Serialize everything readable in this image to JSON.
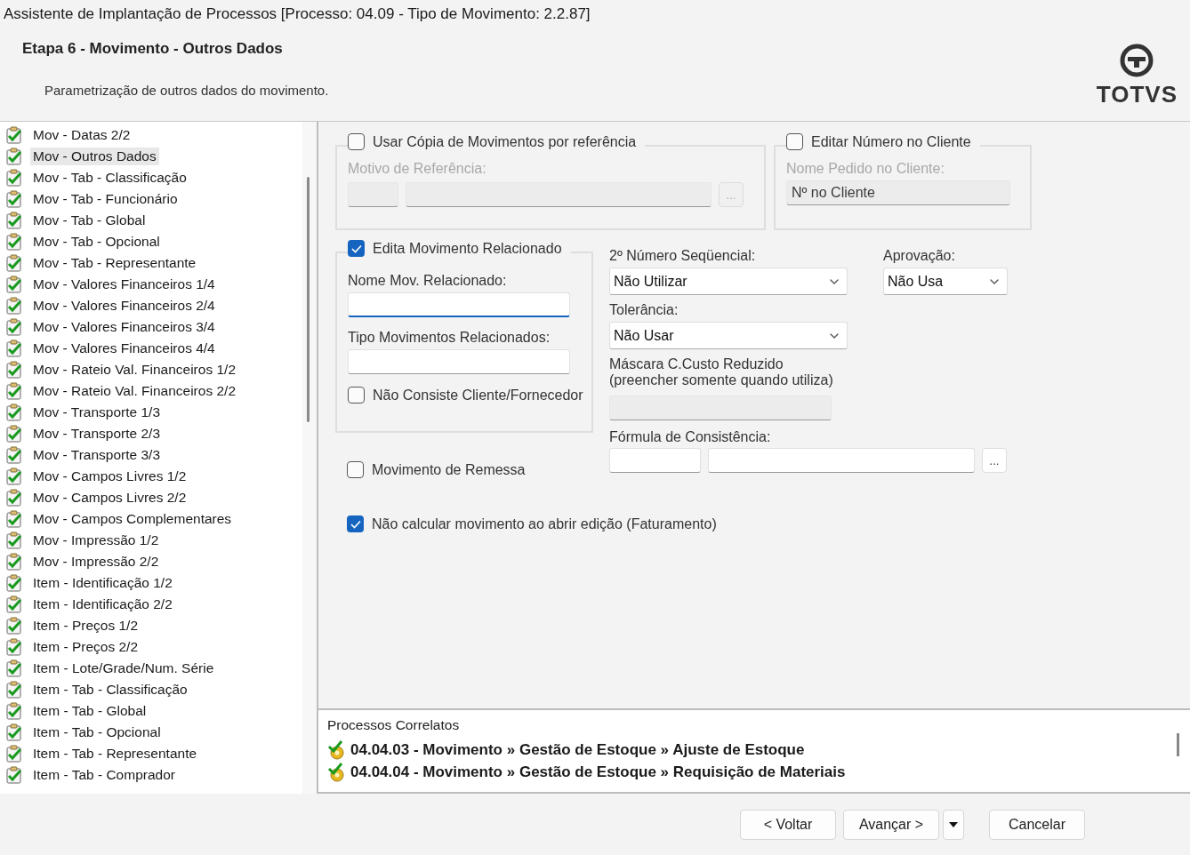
{
  "window": {
    "title": "Assistente de Implantação de Processos [Processo: 04.09 - Tipo de Movimento: 2.2.87]"
  },
  "header": {
    "step_title": "Etapa 6 - Movimento - Outros Dados",
    "subtitle": "Parametrização de outros dados do movimento.",
    "logo_text": "TOTVS"
  },
  "sidebar": {
    "items": [
      {
        "label": "Mov - Datas 2/2",
        "selected": false
      },
      {
        "label": "Mov - Outros Dados",
        "selected": true
      },
      {
        "label": "Mov - Tab - Classificação",
        "selected": false
      },
      {
        "label": "Mov - Tab - Funcionário",
        "selected": false
      },
      {
        "label": "Mov - Tab - Global",
        "selected": false
      },
      {
        "label": "Mov - Tab - Opcional",
        "selected": false
      },
      {
        "label": "Mov - Tab - Representante",
        "selected": false
      },
      {
        "label": "Mov - Valores Financeiros 1/4",
        "selected": false
      },
      {
        "label": "Mov - Valores Financeiros 2/4",
        "selected": false
      },
      {
        "label": "Mov - Valores Financeiros 3/4",
        "selected": false
      },
      {
        "label": "Mov - Valores Financeiros 4/4",
        "selected": false
      },
      {
        "label": "Mov - Rateio Val. Financeiros 1/2",
        "selected": false
      },
      {
        "label": "Mov - Rateio Val. Financeiros 2/2",
        "selected": false
      },
      {
        "label": "Mov - Transporte 1/3",
        "selected": false
      },
      {
        "label": "Mov - Transporte 2/3",
        "selected": false
      },
      {
        "label": "Mov - Transporte 3/3",
        "selected": false
      },
      {
        "label": "Mov - Campos Livres 1/2",
        "selected": false
      },
      {
        "label": "Mov - Campos Livres 2/2",
        "selected": false
      },
      {
        "label": "Mov - Campos Complementares",
        "selected": false
      },
      {
        "label": "Mov - Impressão 1/2",
        "selected": false
      },
      {
        "label": "Mov - Impressão 2/2",
        "selected": false
      },
      {
        "label": "Item - Identificação 1/2",
        "selected": false
      },
      {
        "label": "Item - Identificação 2/2",
        "selected": false
      },
      {
        "label": "Item - Preços 1/2",
        "selected": false
      },
      {
        "label": "Item - Preços 2/2",
        "selected": false
      },
      {
        "label": "Item - Lote/Grade/Num. Série",
        "selected": false
      },
      {
        "label": "Item - Tab - Classificação",
        "selected": false
      },
      {
        "label": "Item - Tab - Global",
        "selected": false
      },
      {
        "label": "Item - Tab - Opcional",
        "selected": false
      },
      {
        "label": "Item - Tab - Representante",
        "selected": false
      },
      {
        "label": "Item - Tab - Comprador",
        "selected": false
      }
    ]
  },
  "form": {
    "copy_group": {
      "label": "Usar Cópia de Movimentos por referência",
      "checked": false,
      "disabled": true,
      "field_label": "Motivo de Referência:",
      "browse": "..."
    },
    "client_group": {
      "label": "Editar Número no Cliente",
      "checked": false,
      "disabled": true,
      "field_label": "Nome Pedido no Cliente:",
      "value": "Nº no Cliente"
    },
    "related_group": {
      "label": "Edita Movimento Relacionado",
      "checked": true,
      "name_label": "Nome Mov. Relacionado:",
      "name_focused": true,
      "type_label": "Tipo Movimentos Relacionados:",
      "type_focused": false,
      "no_check_label": "Não Consiste Cliente/Fornecedor",
      "no_check_checked": false
    },
    "remessa": {
      "label": "Movimento de Remessa",
      "checked": false
    },
    "sequence": {
      "label": "2º Número Seqüencial:",
      "value": "Não Utilizar"
    },
    "approval": {
      "label": "Aprovação:",
      "value": "Não Usa"
    },
    "tolerance": {
      "label": "Tolerância:",
      "value": "Não Usar"
    },
    "mask": {
      "label": "Máscara C.Custo Reduzido",
      "hint": "(preencher somente quando utiliza)",
      "disabled": true
    },
    "formula": {
      "label": "Fórmula de Consistência:",
      "browse": "..."
    },
    "no_calc": {
      "label": "Não calcular movimento ao abrir edição (Faturamento)",
      "checked": true
    }
  },
  "related_processes": {
    "title": "Processos Correlatos",
    "items": [
      "04.04.03 - Movimento » Gestão de Estoque » Ajuste de Estoque",
      "04.04.04 - Movimento » Gestão de Estoque » Requisição de Materiais"
    ]
  },
  "buttons": [
    {
      "kind": "button",
      "label": "< Voltar"
    },
    {
      "kind": "button",
      "label": "Avançar >"
    },
    {
      "kind": "menu"
    },
    {
      "kind": "button",
      "label": "Cancelar"
    }
  ]
}
